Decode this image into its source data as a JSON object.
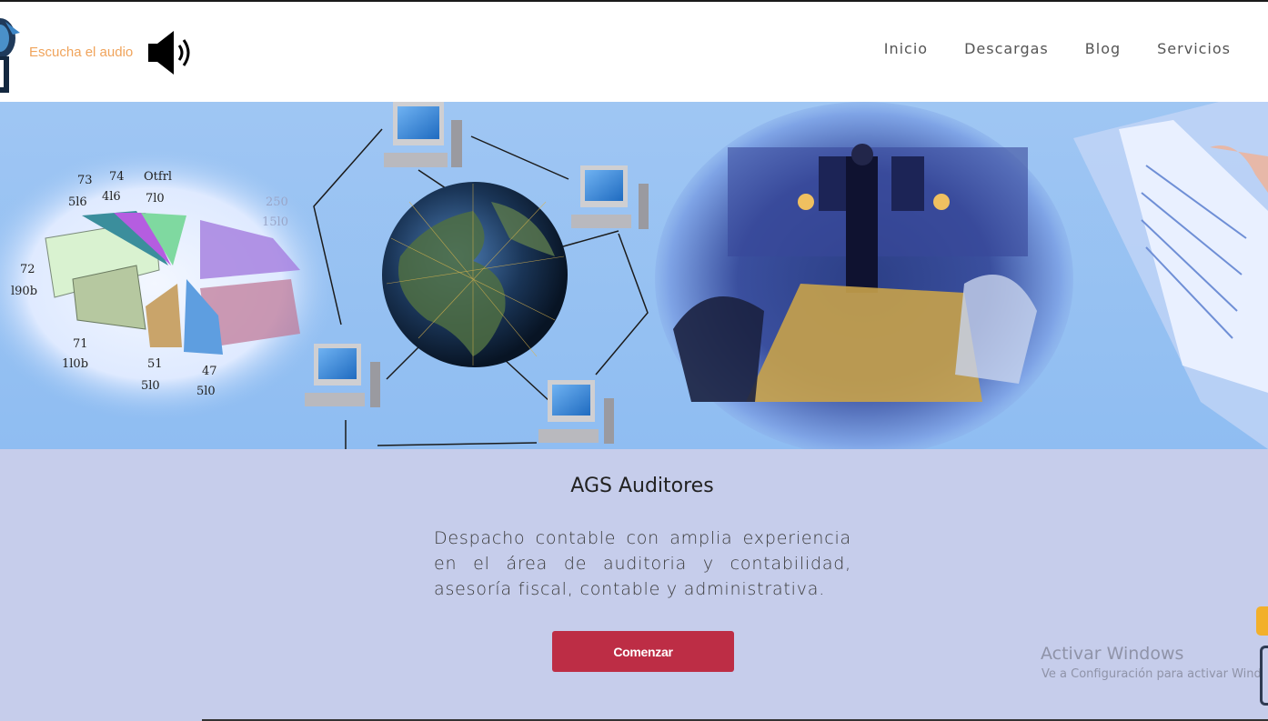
{
  "header": {
    "audio_label": "Escucha el audio",
    "nav": [
      {
        "label": "Inicio"
      },
      {
        "label": "Descargas"
      },
      {
        "label": "Blog"
      },
      {
        "label": "Servicios"
      }
    ]
  },
  "hero": {
    "chart_labels": [
      "73",
      "74",
      "Otfrl",
      "5l6",
      "4l6",
      "7l0",
      "72",
      "l90b",
      "71",
      "1l0b",
      "51",
      "5l0",
      "47",
      "5l0",
      "250",
      "15l0"
    ]
  },
  "main": {
    "title": "AGS Auditores",
    "description": "Despacho contable con amplia experiencia en el área de auditoria y contabilidad, asesoría fiscal, contable y administrativa.",
    "cta_label": "Comenzar"
  },
  "windows_notice": {
    "title": "Activar Windows",
    "subtitle": "Ve a Configuración para activar Windows."
  },
  "colors": {
    "accent": "#bd2d45",
    "audio_label": "#f0a45c",
    "content_bg": "#c6cdeb",
    "hero_bg": "#9fc6f3"
  }
}
